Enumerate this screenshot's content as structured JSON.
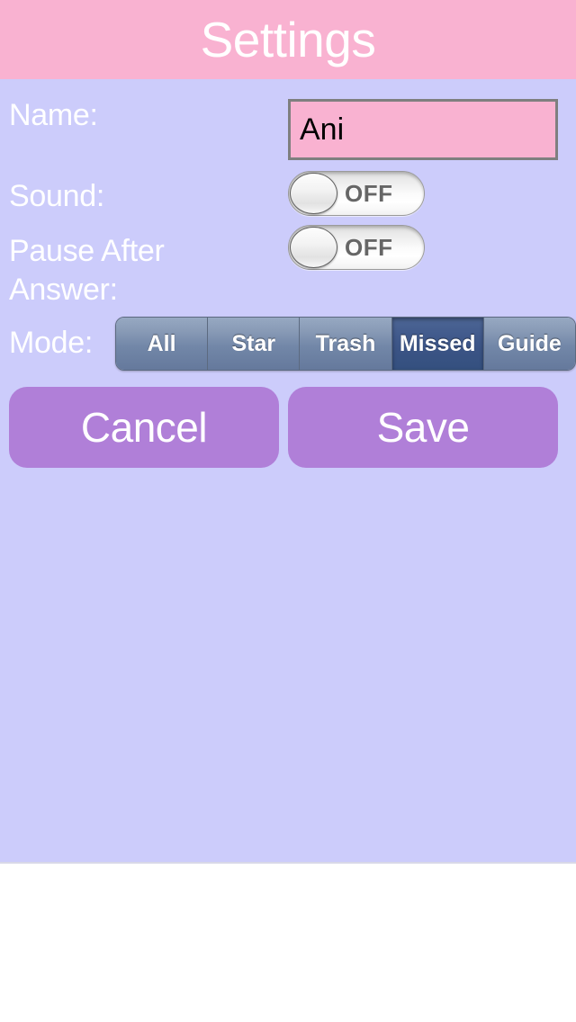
{
  "header": {
    "title": "Settings",
    "bg_color": "#f9b2d1",
    "title_color": "#ffffff"
  },
  "theme": {
    "content_bg": "#ccccfb",
    "label_color": "#ffffff",
    "button_purple": "#b07fd8",
    "field_pink": "#f9b2d1",
    "segment_selected": "#3a5384"
  },
  "form": {
    "name": {
      "label": "Name:",
      "value": "Ani",
      "placeholder": ""
    },
    "sound": {
      "label": "Sound:",
      "state": "OFF",
      "on": false
    },
    "pause_after_answer": {
      "label": "Pause After Answer:",
      "state": "OFF",
      "on": false
    },
    "mode": {
      "label": "Mode:",
      "options": [
        "All",
        "Star",
        "Trash",
        "Missed",
        "Guide"
      ],
      "selected": "Missed",
      "selected_index": 3
    }
  },
  "actions": {
    "cancel_label": "Cancel",
    "save_label": "Save"
  }
}
